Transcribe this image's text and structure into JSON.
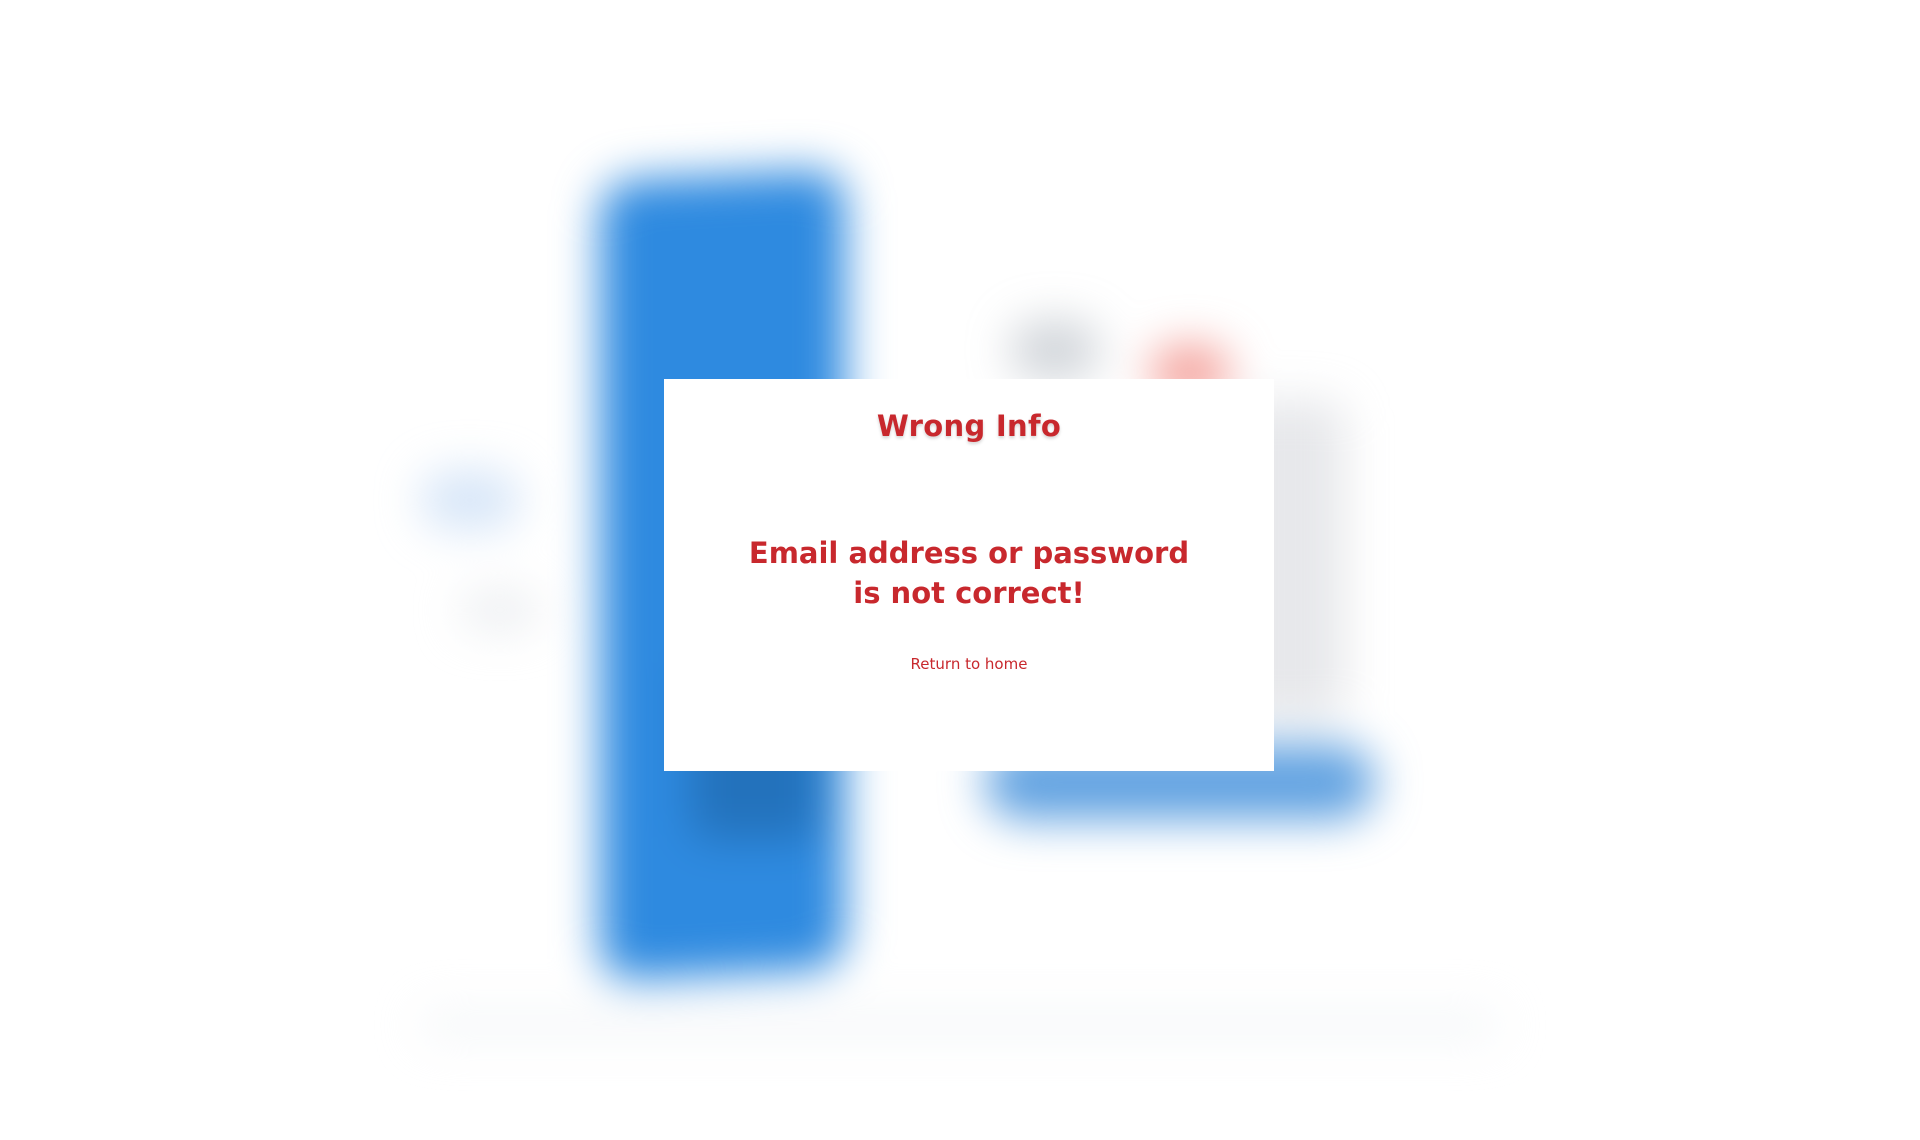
{
  "dialog": {
    "title": "Wrong Info",
    "message_line1": "Email address or password",
    "message_line2": "is not correct!",
    "return_link": "Return to home"
  },
  "colors": {
    "accent_red": "#c8282d",
    "background_blue": "#2e8ae0",
    "dialog_background": "#ffffff"
  }
}
